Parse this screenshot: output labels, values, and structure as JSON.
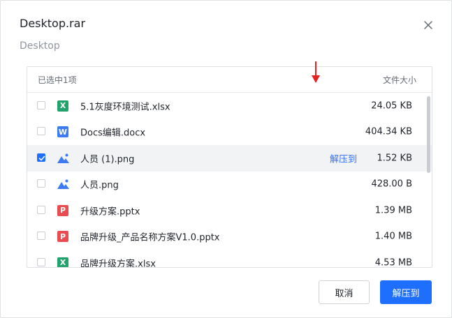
{
  "dialog": {
    "title": "Desktop.rar",
    "subtitle": "Desktop"
  },
  "list_header": {
    "selected_count": "已选中1项",
    "size_column": "文件大小"
  },
  "files": [
    {
      "name": "5.1灰度环境测试.xlsx",
      "size": "24.05 KB",
      "type": "xlsx",
      "icon_glyph": "X",
      "checked": false
    },
    {
      "name": "Docs编辑.docx",
      "size": "404.34 KB",
      "type": "docx",
      "icon_glyph": "W",
      "checked": false
    },
    {
      "name": "人员 (1).png",
      "size": "1.52 KB",
      "type": "png",
      "icon_glyph": "",
      "checked": true
    },
    {
      "name": "人员.png",
      "size": "428.00 B",
      "type": "png",
      "icon_glyph": "",
      "checked": false
    },
    {
      "name": "升级方案.pptx",
      "size": "1.39 MB",
      "type": "pptx",
      "icon_glyph": "P",
      "checked": false
    },
    {
      "name": "品牌升级_产品名称方案V1.0.pptx",
      "size": "1.40 MB",
      "type": "pptx",
      "icon_glyph": "P",
      "checked": false
    },
    {
      "name": "品牌升级方案.xlsx",
      "size": "4.53 MB",
      "type": "xlsx",
      "icon_glyph": "X",
      "checked": false
    }
  ],
  "row_action": {
    "label": "解压到"
  },
  "buttons": {
    "cancel": "取消",
    "extract": "解压到"
  },
  "colors": {
    "primary": "#1f6fff",
    "link": "#3370ff",
    "annotation_arrow": "#e8211e",
    "xlsx": "#22a36b",
    "docx": "#3d7bf5",
    "pptx": "#ea4d4f",
    "image": "#3d7bf5"
  }
}
